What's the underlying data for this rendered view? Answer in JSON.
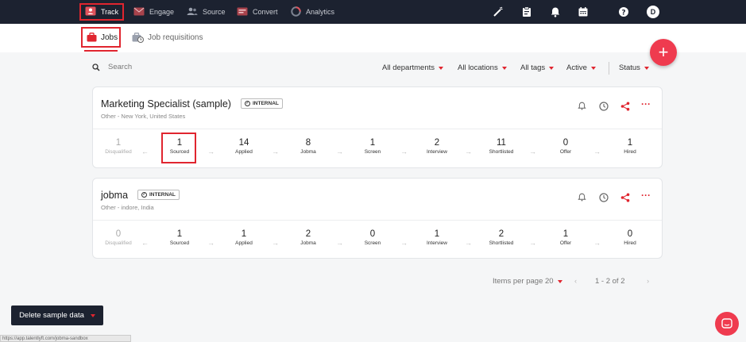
{
  "topnav": {
    "items": [
      {
        "label": "Track",
        "icon": "person-badge-icon",
        "active": true
      },
      {
        "label": "Engage",
        "icon": "envelope-icon"
      },
      {
        "label": "Source",
        "icon": "people-icon"
      },
      {
        "label": "Convert",
        "icon": "card-icon"
      },
      {
        "label": "Analytics",
        "icon": "pie-chart-icon"
      }
    ],
    "avatar_initial": "D"
  },
  "subnav": {
    "tabs": [
      {
        "label": "Jobs",
        "icon": "briefcase-icon"
      },
      {
        "label": "Job requisitions",
        "icon": "briefcase-clock-icon"
      }
    ]
  },
  "search": {
    "placeholder": "Search"
  },
  "filters": {
    "departments": "All departments",
    "locations": "All locations",
    "tags": "All tags",
    "active": "Active",
    "status": "Status"
  },
  "jobs": [
    {
      "title": "Marketing Specialist (sample)",
      "badge": "INTERNAL",
      "subtitle": "Other - New York, United States",
      "stages": [
        {
          "count": "1",
          "label": "Disqualified"
        },
        {
          "count": "1",
          "label": "Sourced"
        },
        {
          "count": "14",
          "label": "Applied"
        },
        {
          "count": "8",
          "label": "Jobma"
        },
        {
          "count": "1",
          "label": "Screen"
        },
        {
          "count": "2",
          "label": "Interview"
        },
        {
          "count": "11",
          "label": "Shortlisted"
        },
        {
          "count": "0",
          "label": "Offer"
        },
        {
          "count": "1",
          "label": "Hired"
        }
      ]
    },
    {
      "title": "jobma",
      "badge": "INTERNAL",
      "subtitle": "Other - indore, India",
      "stages": [
        {
          "count": "0",
          "label": "Disqualified"
        },
        {
          "count": "1",
          "label": "Sourced"
        },
        {
          "count": "1",
          "label": "Applied"
        },
        {
          "count": "2",
          "label": "Jobma"
        },
        {
          "count": "0",
          "label": "Screen"
        },
        {
          "count": "1",
          "label": "Interview"
        },
        {
          "count": "2",
          "label": "Shortlisted"
        },
        {
          "count": "1",
          "label": "Offer"
        },
        {
          "count": "0",
          "label": "Hired"
        }
      ]
    }
  ],
  "pagination": {
    "items_per_page_label": "Items per page 20",
    "range": "1 - 2 of 2"
  },
  "footer": {
    "delete_button": "Delete sample data",
    "status_url": "https://app.talentlyft.com/jobma-sandbox"
  },
  "colors": {
    "accent": "#e0252f",
    "topbar": "#1c2230",
    "fab": "#ef3b4f"
  }
}
